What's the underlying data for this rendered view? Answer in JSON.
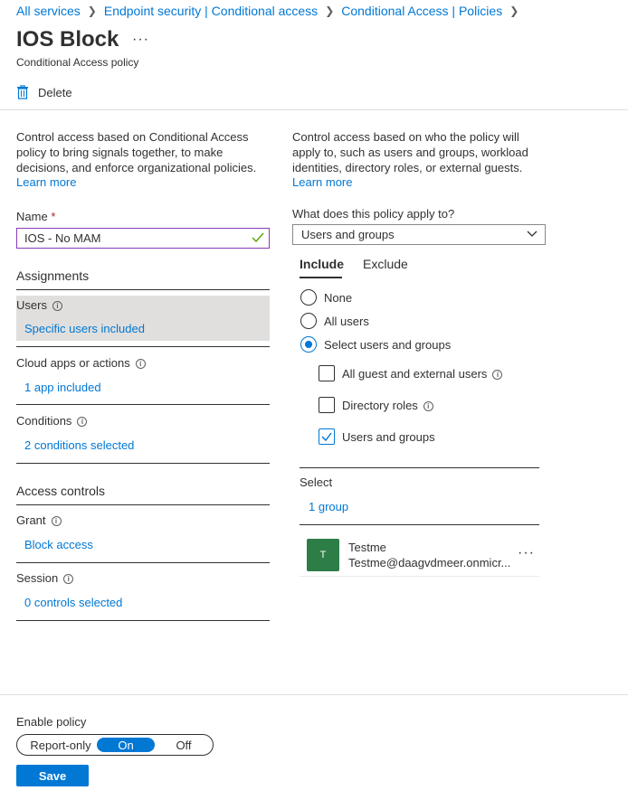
{
  "breadcrumb": [
    "All services",
    "Endpoint security | Conditional access",
    "Conditional Access | Policies"
  ],
  "header": {
    "title": "IOS Block",
    "more": "···",
    "subtitle": "Conditional Access policy"
  },
  "toolbar": {
    "delete_label": "Delete"
  },
  "left": {
    "description": "Control access based on Conditional Access policy to bring signals together, to make decisions, and enforce organizational policies.",
    "learn_more": "Learn more",
    "name_label": "Name",
    "name_required": "*",
    "name_value": "IOS - No MAM",
    "assignments_heading": "Assignments",
    "users_label": "Users",
    "users_value": "Specific users included",
    "cloud_label": "Cloud apps or actions",
    "cloud_value": "1 app included",
    "conditions_label": "Conditions",
    "conditions_value": "2 conditions selected",
    "access_heading": "Access controls",
    "grant_label": "Grant",
    "grant_value": "Block access",
    "session_label": "Session",
    "session_value": "0 controls selected"
  },
  "right": {
    "description": "Control access based on who the policy will apply to, such as users and groups, workload identities, directory roles, or external guests.",
    "learn_more": "Learn more",
    "apply_label": "What does this policy apply to?",
    "apply_value": "Users and groups",
    "tabs": [
      "Include",
      "Exclude"
    ],
    "radios": [
      "None",
      "All users",
      "Select users and groups"
    ],
    "checkboxes": [
      "All guest and external users",
      "Directory roles",
      "Users and groups"
    ],
    "select_label": "Select",
    "select_value": "1 group",
    "user": {
      "initial": "T",
      "name": "Testme",
      "email": "Testme@daagvdmeer.onmicr...",
      "more": "···"
    }
  },
  "footer": {
    "enable_label": "Enable policy",
    "toggle": [
      "Report-only",
      "On",
      "Off"
    ],
    "save_label": "Save"
  },
  "colors": {
    "accent": "#0078d4",
    "avatar": "#2d7d46",
    "selected_bg": "#e1dfdd",
    "focus_border": "#8a3ab9"
  }
}
